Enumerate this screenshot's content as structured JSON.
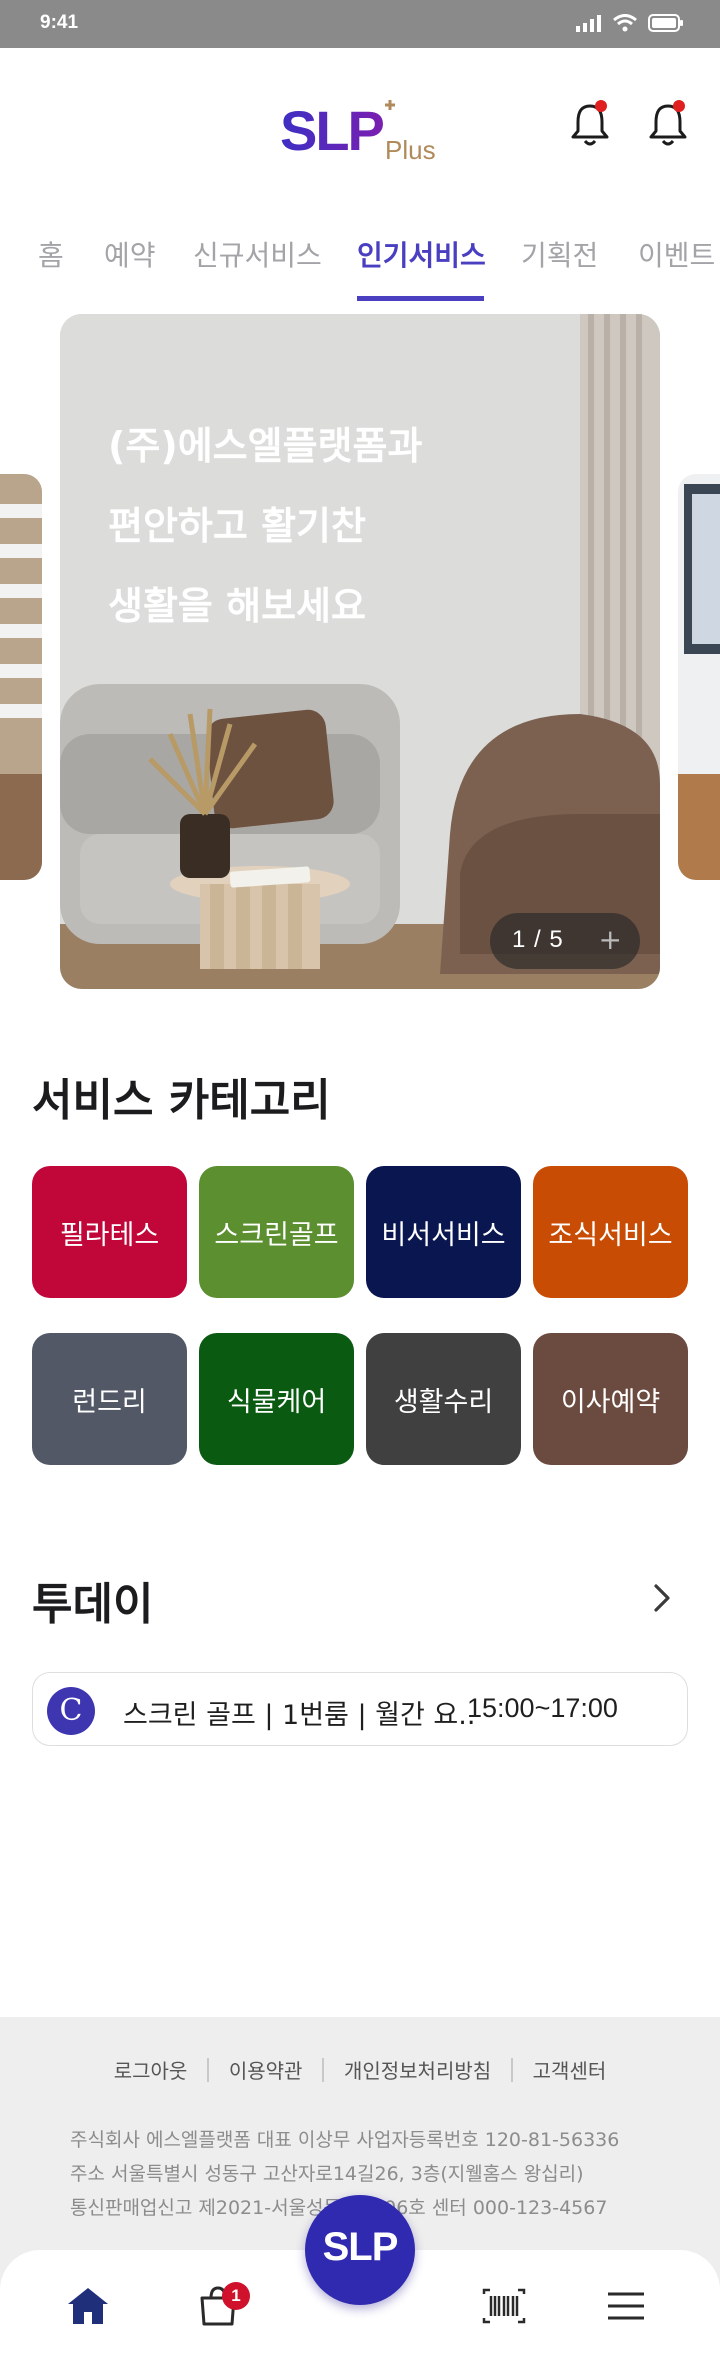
{
  "status_bar": {
    "time": "9:41"
  },
  "header": {
    "logo_main": "SLP",
    "logo_sub": "Plus"
  },
  "tabs": [
    {
      "label": "홈"
    },
    {
      "label": "예약"
    },
    {
      "label": "신규서비스"
    },
    {
      "label": "인기서비스"
    },
    {
      "label": "기획전"
    },
    {
      "label": "이벤트"
    }
  ],
  "active_tab": "인기서비스",
  "banner": {
    "line1": "(주)에스엘플랫폼과",
    "line2": "편안하고 활기찬",
    "line3": "생활을 해보세요",
    "pager": "1 / 5",
    "plus": "+"
  },
  "categories": {
    "title": "서비스 카테고리",
    "items": [
      {
        "label": "필라테스",
        "color": "#C1073A"
      },
      {
        "label": "스크린골프",
        "color": "#5B8F2F"
      },
      {
        "label": "비서서비스",
        "color": "#0A1650"
      },
      {
        "label": "조식서비스",
        "color": "#C94C04"
      },
      {
        "label": "런드리",
        "color": "#525866"
      },
      {
        "label": "식물케어",
        "color": "#0A5A12"
      },
      {
        "label": "생활수리",
        "color": "#404040"
      },
      {
        "label": "이사예약",
        "color": "#6B4A3F"
      }
    ]
  },
  "today": {
    "title": "투데이",
    "item": {
      "avatar": "C",
      "text": "스크린 골프 | 1번룸 | 월간 요..",
      "time": "15:00~17:00"
    }
  },
  "footer": {
    "links": [
      "로그아웃",
      "이용약관",
      "개인정보처리방침",
      "고객센터"
    ],
    "line1": "주식회사 에스엘플랫폼    대표  이상무    사업자등록번호  120-81-56336",
    "line2": "주소  서울특별시 성동구 고산자로14길26, 3층(지웰홈스 왕십리)",
    "line3": "통신판매업신고  제2021-서울성동-01006호    센터  000-123-4567"
  },
  "bottom_nav": {
    "fab_label": "SLP",
    "cart_count": "1"
  },
  "colors": {
    "accent": "#4A3FC0",
    "fab": "#2F2AB0",
    "badge": "#D0112B"
  }
}
